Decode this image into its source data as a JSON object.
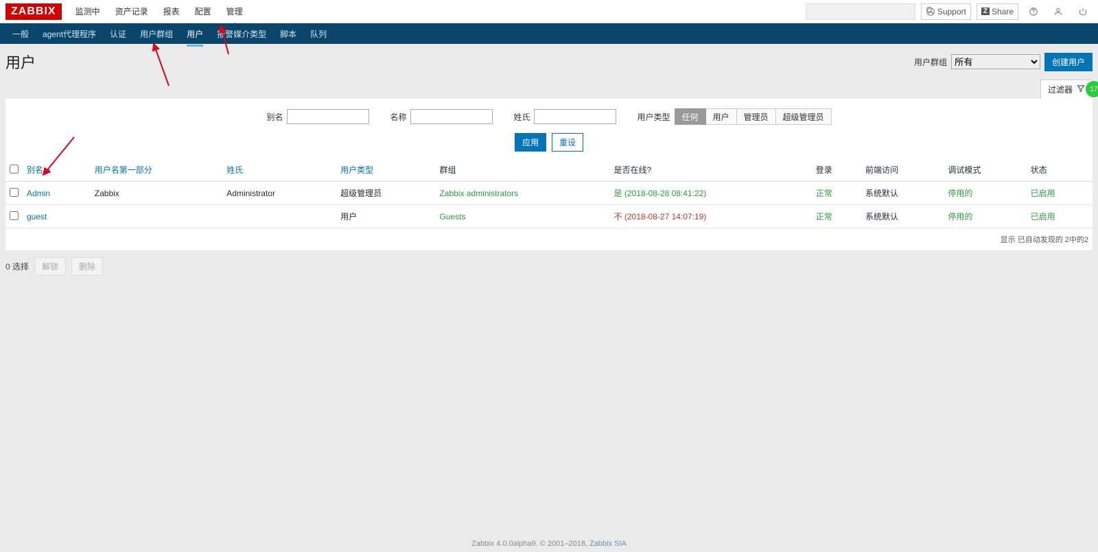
{
  "logo": "ZABBIX",
  "top_nav": [
    "监测中",
    "资产记录",
    "报表",
    "配置",
    "管理"
  ],
  "top_nav_active": 4,
  "top_right": {
    "support": "Support",
    "share": "Share"
  },
  "sub_nav": [
    "一般",
    "agent代理程序",
    "认证",
    "用户群组",
    "用户",
    "报警媒介类型",
    "脚本",
    "队列"
  ],
  "sub_nav_active": 4,
  "page_title": "用户",
  "header": {
    "group_label": "用户群组",
    "group_selected": "所有",
    "create_btn": "创建用户"
  },
  "filter": {
    "tab_label": "过滤器",
    "alias_label": "别名",
    "name_label": "名称",
    "surname_label": "姓氏",
    "type_label": "用户类型",
    "type_options": [
      "任何",
      "用户",
      "管理员",
      "超级管理员"
    ],
    "type_selected": 0,
    "apply": "应用",
    "reset": "重设"
  },
  "columns": {
    "alias": "别名",
    "first": "用户名第一部分",
    "surname": "姓氏",
    "type": "用户类型",
    "groups": "群组",
    "online": "是否在线?",
    "login": "登录",
    "frontend": "前端访问",
    "debug": "调试模式",
    "status": "状态"
  },
  "rows": [
    {
      "alias": "Admin",
      "first": "Zabbix",
      "surname": "Administrator",
      "type": "超级管理员",
      "groups": "Zabbix administrators",
      "online_text": "是 (2018-08-28 08:41:22)",
      "online_cls": "green",
      "login": "正常",
      "frontend": "系统默认",
      "debug": "停用的",
      "status": "已启用"
    },
    {
      "alias": "guest",
      "first": "",
      "surname": "",
      "type": "用户",
      "groups": "Guests",
      "online_text": "不 (2018-08-27 14:07:19)",
      "online_cls": "red",
      "login": "正常",
      "frontend": "系统默认",
      "debug": "停用的",
      "status": "已启用"
    }
  ],
  "table_footer": "显示 已自动发现的 2中的2",
  "sort_indicator": "▲",
  "selected_count": "0 选择",
  "mass_actions": {
    "unblock": "解锁",
    "delete": "删除"
  },
  "footer": {
    "text": "Zabbix 4.0.0alpha9. © 2001–2018, ",
    "link": "Zabbix SIA"
  },
  "side_badge": "17"
}
